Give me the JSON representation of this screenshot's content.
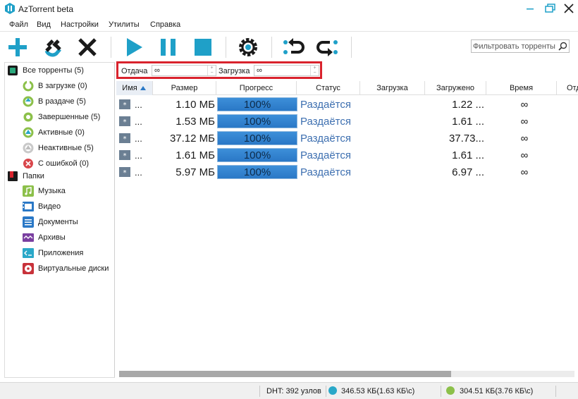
{
  "window": {
    "title": "AzTorrent beta"
  },
  "menu": [
    "Файл",
    "Вид",
    "Настройки",
    "Утилиты",
    "Справка"
  ],
  "toolbar": {
    "buttons": [
      "add-icon",
      "magnet-icon",
      "remove-icon",
      "play-icon",
      "pause-icon",
      "stop-icon",
      "settings-icon",
      "move-up-icon",
      "move-down-icon"
    ],
    "filter_placeholder": "Фильтровать торренты"
  },
  "sidebar": {
    "all": "Все торренты (5)",
    "status_items": [
      {
        "label": "В загрузке (0)",
        "icon": "downloading-icon"
      },
      {
        "label": "В раздаче (5)",
        "icon": "seeding-icon"
      },
      {
        "label": "Завершенные (5)",
        "icon": "completed-icon"
      },
      {
        "label": "Активные (0)",
        "icon": "active-icon"
      },
      {
        "label": "Неактивные (5)",
        "icon": "inactive-icon"
      },
      {
        "label": "С ошибкой (0)",
        "icon": "error-icon"
      }
    ],
    "folders_label": "Папки",
    "folder_items": [
      {
        "label": "Музыка",
        "icon": "music-icon"
      },
      {
        "label": "Видео",
        "icon": "video-icon"
      },
      {
        "label": "Документы",
        "icon": "documents-icon"
      },
      {
        "label": "Архивы",
        "icon": "archives-icon"
      },
      {
        "label": "Приложения",
        "icon": "applications-icon"
      },
      {
        "label": "Виртуальные диски",
        "icon": "virtual-disk-icon"
      }
    ]
  },
  "limits": {
    "upload_label": "Отдача",
    "upload_value": "∞",
    "download_label": "Загрузка",
    "download_value": "∞"
  },
  "table": {
    "columns": [
      "Имя",
      "Размер",
      "Прогресс",
      "Статус",
      "Загрузка",
      "Загружено",
      "Время",
      "Отдача"
    ],
    "sort_column": "Имя",
    "rows": [
      {
        "name": "...",
        "size": "1.10 МБ",
        "progress": "100%",
        "progress_value": 1.0,
        "status": "Раздаётся",
        "download": "",
        "downloaded": "1.22 ...",
        "time": "∞"
      },
      {
        "name": "...",
        "size": "1.53 МБ",
        "progress": "100%",
        "progress_value": 1.0,
        "status": "Раздаётся",
        "download": "",
        "downloaded": "1.61 ...",
        "time": "∞"
      },
      {
        "name": "...",
        "size": "37.12 МБ",
        "progress": "100%",
        "progress_value": 1.0,
        "status": "Раздаётся",
        "download": "",
        "downloaded": "37.73...",
        "time": "∞"
      },
      {
        "name": "...",
        "size": "1.61 МБ",
        "progress": "100%",
        "progress_value": 1.0,
        "status": "Раздаётся",
        "download": "",
        "downloaded": "1.61 ...",
        "time": "∞"
      },
      {
        "name": "...",
        "size": "5.97 МБ",
        "progress": "100%",
        "progress_value": 1.0,
        "status": "Раздаётся",
        "download": "",
        "downloaded": "6.97 ...",
        "time": "∞"
      }
    ]
  },
  "statusbar": {
    "dht": "DHT: 392 узлов",
    "download_speed": "346.53 КБ(1.63 КБ\\с)",
    "upload_speed": "304.51 КБ(3.76 КБ\\с)"
  },
  "colors": {
    "accent": "#2a78c6",
    "toolbar_icon": "#1fa0c8",
    "limits_border": "#d9232d",
    "status_text": "#3d6fb0",
    "download_dot": "#2aa8c8",
    "upload_dot": "#8cc04a"
  }
}
